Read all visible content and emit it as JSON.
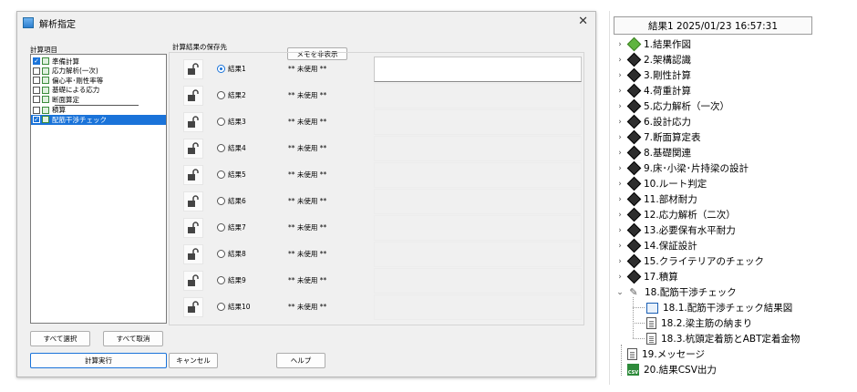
{
  "dialog": {
    "title": "解析指定",
    "close_symbol": "✕",
    "calc_items_label": "計算項目",
    "list_items": [
      {
        "label": "準備計算",
        "checked": true,
        "selected": false
      },
      {
        "label": "応力解析(一次)",
        "checked": false,
        "selected": false
      },
      {
        "label": "偏心率･剛性率等",
        "checked": false,
        "selected": false
      },
      {
        "label": "基礎による応力",
        "checked": false,
        "selected": false
      },
      {
        "label": "断面算定",
        "checked": false,
        "selected": false
      },
      {
        "label": "積算",
        "checked": false,
        "selected": false
      },
      {
        "label": "配筋干渉チェック",
        "checked": true,
        "selected": true
      }
    ],
    "save_dest_label": "計算結果の保存先",
    "memo_toggle_label": "メモを非表示",
    "select_all_label": "すべて選択",
    "deselect_all_label": "すべて取消",
    "run_label": "計算実行",
    "cancel_label": "キャンセル",
    "help_label": "ヘルプ",
    "slots": [
      {
        "label": "結果1",
        "status": "** 未使用 **",
        "selected": true
      },
      {
        "label": "結果2",
        "status": "** 未使用 **",
        "selected": false
      },
      {
        "label": "結果3",
        "status": "** 未使用 **",
        "selected": false
      },
      {
        "label": "結果4",
        "status": "** 未使用 **",
        "selected": false
      },
      {
        "label": "結果5",
        "status": "** 未使用 **",
        "selected": false
      },
      {
        "label": "結果6",
        "status": "** 未使用 **",
        "selected": false
      },
      {
        "label": "結果7",
        "status": "** 未使用 **",
        "selected": false
      },
      {
        "label": "結果8",
        "status": "** 未使用 **",
        "selected": false
      },
      {
        "label": "結果9",
        "status": "** 未使用 **",
        "selected": false
      },
      {
        "label": "結果10",
        "status": "** 未使用 **",
        "selected": false
      }
    ]
  },
  "tree": {
    "header": "結果1  2025/01/23 16:57:31",
    "nodes": [
      {
        "label": "1.結果作図",
        "icon": "green-diamond-icon",
        "chevron": "›"
      },
      {
        "label": "2.架構認識",
        "icon": "diamond-icon",
        "chevron": "›"
      },
      {
        "label": "3.剛性計算",
        "icon": "diamond-icon",
        "chevron": "›"
      },
      {
        "label": "4.荷重計算",
        "icon": "diamond-icon",
        "chevron": "›"
      },
      {
        "label": "5.応力解析（一次）",
        "icon": "diamond-icon",
        "chevron": "›"
      },
      {
        "label": "6.設計応力",
        "icon": "diamond-icon",
        "chevron": "›"
      },
      {
        "label": "7.断面算定表",
        "icon": "diamond-icon",
        "chevron": "›"
      },
      {
        "label": "8.基礎関連",
        "icon": "diamond-icon",
        "chevron": "›"
      },
      {
        "label": "9.床･小梁･片持梁の設計",
        "icon": "diamond-icon",
        "chevron": "›"
      },
      {
        "label": "10.ルート判定",
        "icon": "diamond-icon",
        "chevron": "›"
      },
      {
        "label": "11.部材耐力",
        "icon": "diamond-icon",
        "chevron": "›"
      },
      {
        "label": "12.応力解析（二次）",
        "icon": "diamond-icon",
        "chevron": "›"
      },
      {
        "label": "13.必要保有水平耐力",
        "icon": "diamond-icon",
        "chevron": "›"
      },
      {
        "label": "14.保証設計",
        "icon": "diamond-icon",
        "chevron": "›"
      },
      {
        "label": "15.クライテリアのチェック",
        "icon": "diamond-icon",
        "chevron": "›"
      },
      {
        "label": "17.積算",
        "icon": "diamond-icon",
        "chevron": "›"
      },
      {
        "label": "18.配筋干渉チェック",
        "icon": "pen-icon",
        "chevron": "⌄"
      }
    ],
    "children": [
      {
        "label": "18.1.配筋干渉チェック結果図",
        "icon": "image-icon"
      },
      {
        "label": "18.2.梁主筋の納まり",
        "icon": "document-icon"
      },
      {
        "label": "18.3.杭頭定着筋とABT定着金物",
        "icon": "document-icon"
      }
    ],
    "tail": [
      {
        "label": "19.メッセージ",
        "icon": "document-icon"
      },
      {
        "label": "20.結果CSV出力",
        "icon": "csv-icon",
        "icon_text": "CSV"
      }
    ]
  }
}
